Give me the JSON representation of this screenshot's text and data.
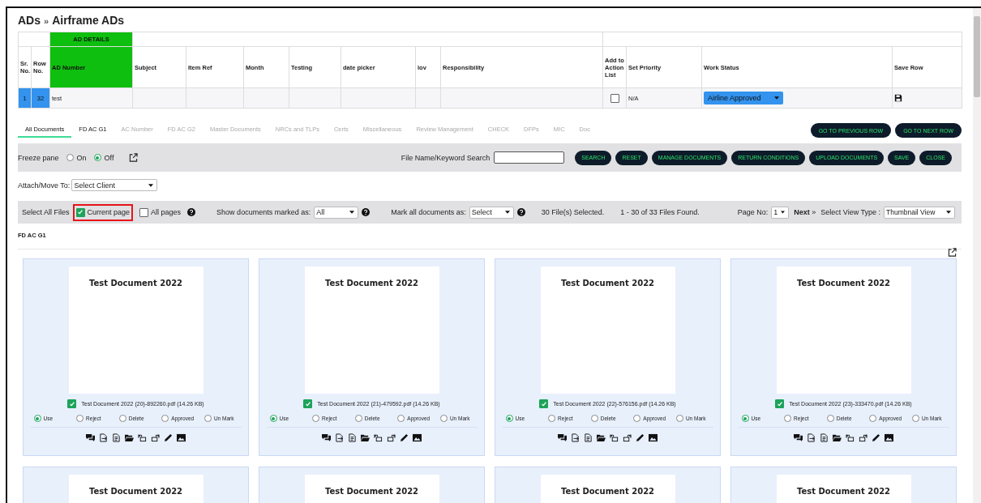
{
  "breadcrumb": {
    "parent": "ADs",
    "separator": "»",
    "current": "Airframe ADs"
  },
  "ad_table": {
    "group_header": "AD DETAILS",
    "columns": [
      "Sr. No.",
      "Row No.",
      "AD Number",
      "Subject",
      "Item Ref",
      "Month",
      "Testing",
      "date picker",
      "lov",
      "Responsibility",
      "Add to Action List",
      "Set Priority",
      "Work Status",
      "Save Row"
    ],
    "rows": [
      {
        "selected": true,
        "sr_no": "1",
        "row_no": "32",
        "ad_number": "test",
        "add_to_action_list": false,
        "priority": "N/A",
        "work_status": "Airline Approved"
      }
    ]
  },
  "tabs": [
    {
      "label": "All Documents",
      "selected": true,
      "disabled": false
    },
    {
      "label": "FD AC G1",
      "selected": false,
      "disabled": false
    },
    {
      "label": "AC Number",
      "selected": false,
      "disabled": true
    },
    {
      "label": "FD AC G2",
      "selected": false,
      "disabled": true
    },
    {
      "label": "Master Documents",
      "selected": false,
      "disabled": true
    },
    {
      "label": "NRCs and TLPs",
      "selected": false,
      "disabled": true
    },
    {
      "label": "Certs",
      "selected": false,
      "disabled": true
    },
    {
      "label": "Miscellaneous",
      "selected": false,
      "disabled": true
    },
    {
      "label": "Review Management",
      "selected": false,
      "disabled": true
    },
    {
      "label": "CHECK",
      "selected": false,
      "disabled": true
    },
    {
      "label": "DFPs",
      "selected": false,
      "disabled": true
    },
    {
      "label": "MIC",
      "selected": false,
      "disabled": true
    },
    {
      "label": "Doc",
      "selected": false,
      "disabled": true
    }
  ],
  "nav_buttons": [
    "GO TO PREVIOUS ROW",
    "GO TO NEXT ROW"
  ],
  "freeze_pane": {
    "label": "Freeze pane",
    "options": [
      {
        "label": "On",
        "selected": false
      },
      {
        "label": "Off",
        "selected": true
      }
    ]
  },
  "search": {
    "label": "File Name/Keyword Search"
  },
  "action_buttons": [
    "SEARCH",
    "RESET",
    "MANAGE DOCUMENTS",
    "RETURN CONDITIONS",
    "UPLOAD DOCUMENTS",
    "SAVE",
    "CLOSE"
  ],
  "attach": {
    "label": "Attach/Move To:",
    "value": "Select Client"
  },
  "select_bar": {
    "label": "Select All Files",
    "options": [
      {
        "label": "Current page",
        "checked": true,
        "highlighted": true
      },
      {
        "label": "All pages",
        "checked": false,
        "highlighted": false
      }
    ],
    "show_label": "Show documents marked as:",
    "show_value": "All",
    "mark_label": "Mark all documents as:",
    "mark_value": "Select",
    "selected_count": "30 File(s) Selected.",
    "found": "1 - 30 of 33 Files Found.",
    "page_label": "Page No:",
    "page_value": "1",
    "next": "Next",
    "next_mark": "»",
    "view_label": "Select View Type :",
    "view_value": "Thumbnail View"
  },
  "section_title": "FD AC G1",
  "cards": [
    {
      "preview_title": "Test Document 2022",
      "filename": "Test Document 2022 (20)-892260.pdf (14.26 KB)",
      "checked": true,
      "marks": [
        {
          "label": "Use",
          "selected": true
        },
        {
          "label": "Reject",
          "selected": false
        },
        {
          "label": "Delete",
          "selected": false
        },
        {
          "label": "Approved",
          "selected": false
        },
        {
          "label": "Un Mark",
          "selected": false
        }
      ]
    },
    {
      "preview_title": "Test Document 2022",
      "filename": "Test Document 2022 (21)-479592.pdf (14.26 KB)",
      "checked": true,
      "marks": [
        {
          "label": "Use",
          "selected": true
        },
        {
          "label": "Reject",
          "selected": false
        },
        {
          "label": "Delete",
          "selected": false
        },
        {
          "label": "Approved",
          "selected": false
        },
        {
          "label": "Un Mark",
          "selected": false
        }
      ]
    },
    {
      "preview_title": "Test Document 2022",
      "filename": "Test Document 2022 (22)-576156.pdf (14.26 KB)",
      "checked": true,
      "marks": [
        {
          "label": "Use",
          "selected": true
        },
        {
          "label": "Reject",
          "selected": false
        },
        {
          "label": "Delete",
          "selected": false
        },
        {
          "label": "Approved",
          "selected": false
        },
        {
          "label": "Un Mark",
          "selected": false
        }
      ]
    },
    {
      "preview_title": "Test Document 2022",
      "filename": "Test Document 2022 (23)-333470.pdf (14.26 KB)",
      "checked": true,
      "marks": [
        {
          "label": "Use",
          "selected": true
        },
        {
          "label": "Reject",
          "selected": false
        },
        {
          "label": "Delete",
          "selected": false
        },
        {
          "label": "Approved",
          "selected": false
        },
        {
          "label": "Un Mark",
          "selected": false
        }
      ]
    },
    {
      "preview_title": "Test Document 2022"
    },
    {
      "preview_title": "Test Document 2022"
    },
    {
      "preview_title": "Test Document 2022"
    },
    {
      "preview_title": "Test Document 2022"
    }
  ]
}
